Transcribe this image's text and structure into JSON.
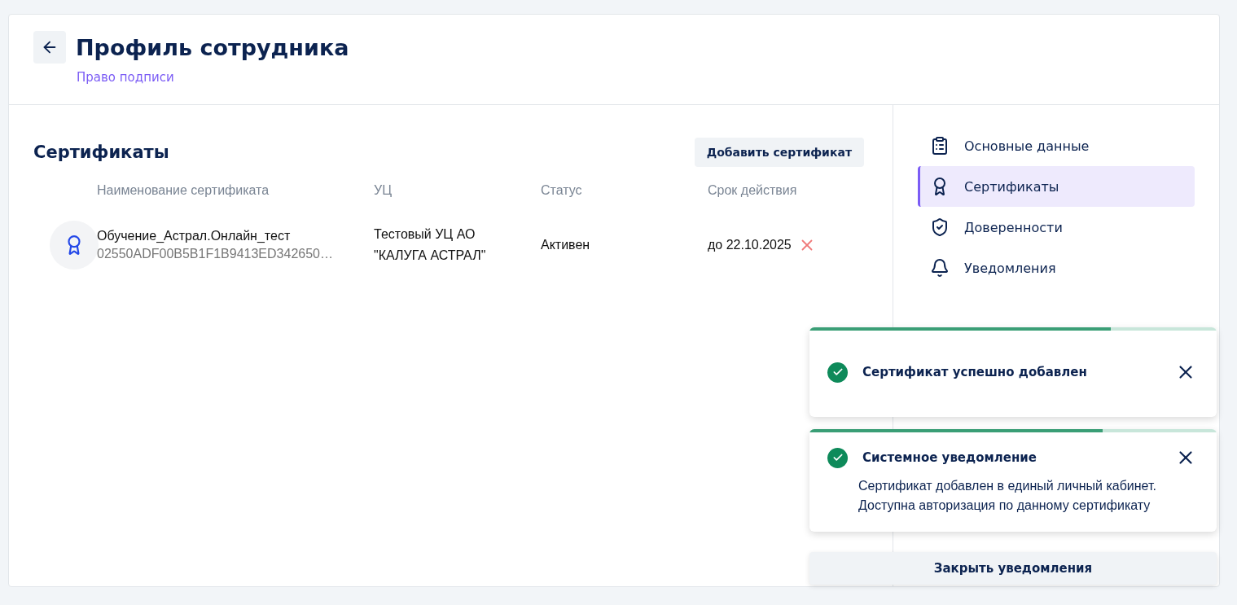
{
  "header": {
    "title": "Профиль сотрудника",
    "subtitle": "Право подписи"
  },
  "section": {
    "title": "Сертификаты",
    "add_button": "Добавить сертификат"
  },
  "table": {
    "columns": [
      "Наименование сертификата",
      "УЦ",
      "Статус",
      "Срок действия"
    ],
    "rows": [
      {
        "name": "Обучение_Астрал.Онлайн_тест",
        "serial": "02550ADF00B5B1F1B9413ED342650…",
        "ca": [
          "Тестовый УЦ АО",
          "\"КАЛУГА АСТРАЛ\""
        ],
        "status": "Активен",
        "valid": "до 22.10.2025"
      }
    ]
  },
  "nav": {
    "items": [
      {
        "kind": "clipboard",
        "label": "Основные данные",
        "selected": false
      },
      {
        "kind": "award",
        "label": "Сертификаты",
        "selected": true
      },
      {
        "kind": "shield",
        "label": "Доверенности",
        "selected": false
      },
      {
        "kind": "bell",
        "label": "Уведомления",
        "selected": false
      }
    ]
  },
  "toasts": [
    {
      "title": "Сертификат успешно добавлен",
      "level": 0.74
    },
    {
      "title": "Системное уведомление",
      "body": [
        "Сертификат добавлен в единый личный кабинет.",
        "Доступна авторизация по данному сертификату"
      ],
      "level": 0.72
    }
  ],
  "close_all_button": "Закрыть уведомления"
}
